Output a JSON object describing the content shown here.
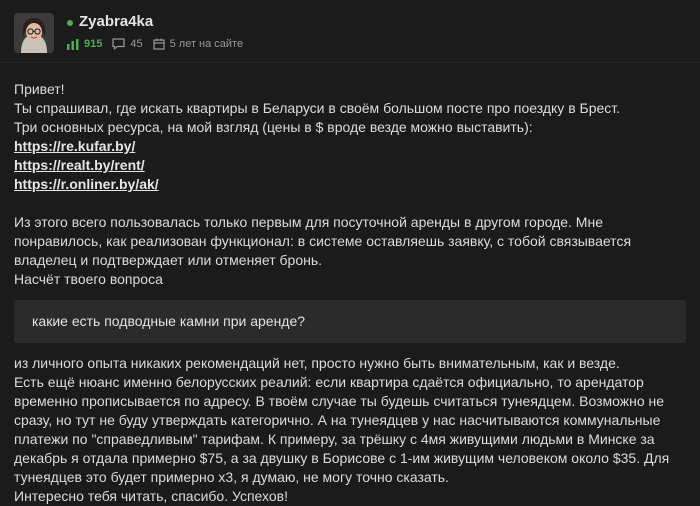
{
  "author": {
    "username": "Zyabra4ka",
    "rating": "915",
    "comments": "45",
    "tenure": "5 лет на сайте",
    "icons": {
      "rating": "rating-chart-icon",
      "comments": "comment-icon",
      "tenure": "calendar-icon"
    }
  },
  "colors": {
    "accent": "#4cae4c",
    "background": "#1b1b1b",
    "quote_bg": "#2b2b2b"
  },
  "post": {
    "p1": [
      "Привет!",
      "Ты спрашивал, где искать квартиры в Беларуси в своём большом посте про поездку в Брест.",
      "Три основных ресурса, на мой взгляд (цены в $ вроде везде можно выставить):"
    ],
    "links": [
      "https://re.kufar.by/",
      "https://realt.by/rent/",
      "https://r.onliner.by/ak/"
    ],
    "p2": "Из этого всего пользовалась только первым для посуточной аренды в другом городе. Мне понравилось, как реализован функционал: в системе оставляешь заявку, с тобой связывается владелец и подтверждает или отменяет бронь.",
    "p3": "Насчёт твоего вопроса",
    "quote": "какие есть подводные камни при аренде?",
    "p4": "из личного опыта никаких рекомендаций нет, просто нужно быть внимательным, как и везде.",
    "p5": "Есть ещё нюанс именно белорусских реалий: если квартира сдаётся официально, то арендатор временно прописывается по адресу. В твоём случае ты будешь считаться тунеядцем. Возможно не сразу, но тут не буду утверждать категорично. А на тунеядцев у нас насчитываются коммунальные платежи по \"справедливым\" тарифам. К примеру, за трёшку с 4мя живущими людьми в Минске за декабрь я отдала примерно $75, а за двушку в Борисове с 1-им живущим человеком около $35. Для тунеядцев это будет примерно х3, я думаю, не могу точно сказать.",
    "p6": "Интересно тебя читать, спасибо. Успехов!"
  }
}
